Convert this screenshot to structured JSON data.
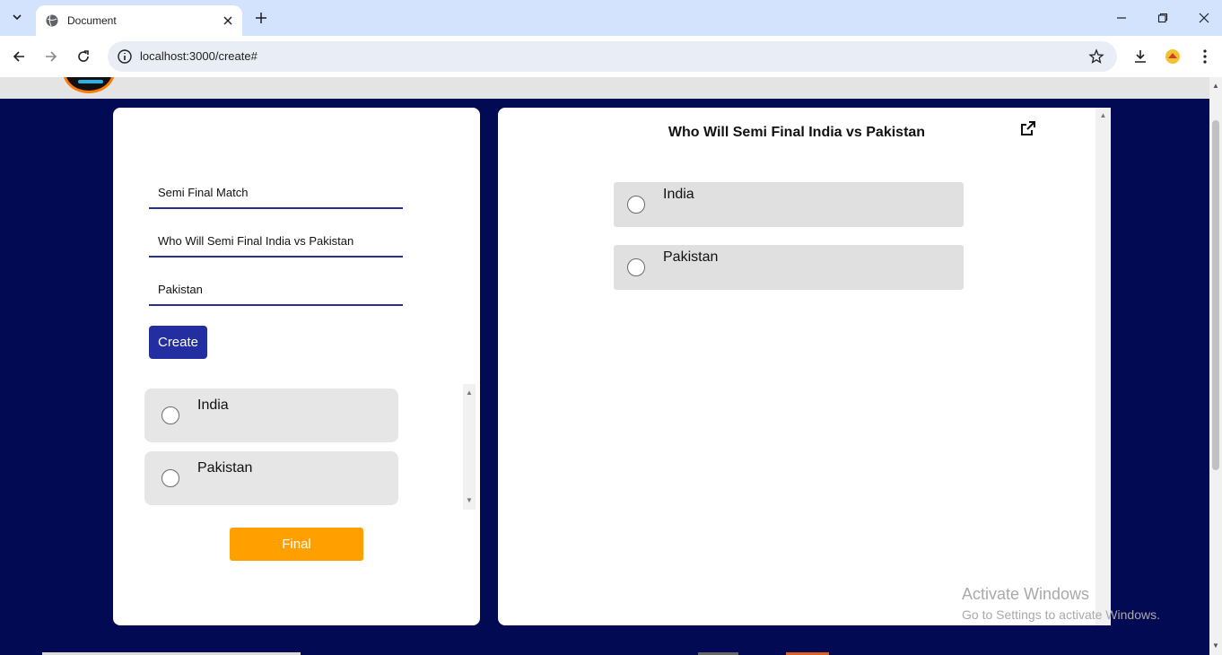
{
  "browser": {
    "tab_title": "Document",
    "url": "localhost:3000/create#"
  },
  "left_panel": {
    "fields": [
      {
        "value": "Semi Final Match"
      },
      {
        "value": "Who Will Semi Final India vs Pakistan"
      },
      {
        "value": "Pakistan"
      }
    ],
    "create_label": "Create",
    "options": [
      "India",
      "Pakistan"
    ],
    "final_label": "Final"
  },
  "preview": {
    "title": "Who Will Semi Final India vs Pakistan",
    "options": [
      "India",
      "Pakistan"
    ]
  },
  "watermark": {
    "line1": "Activate Windows",
    "line2": "Go to Settings to activate Windows."
  },
  "colors": {
    "page_bg": "#030a54",
    "create_button": "#232ea0",
    "final_button": "#ffa000",
    "input_underline": "#2a2f8f"
  },
  "icons": [
    "tab-search-icon",
    "globe-icon",
    "close-icon",
    "plus-icon",
    "minimize-icon",
    "restore-icon",
    "window-close-icon",
    "back-icon",
    "forward-icon",
    "reload-icon",
    "info-icon",
    "star-icon",
    "download-icon",
    "extension-icon",
    "menu-icon",
    "share-icon"
  ]
}
